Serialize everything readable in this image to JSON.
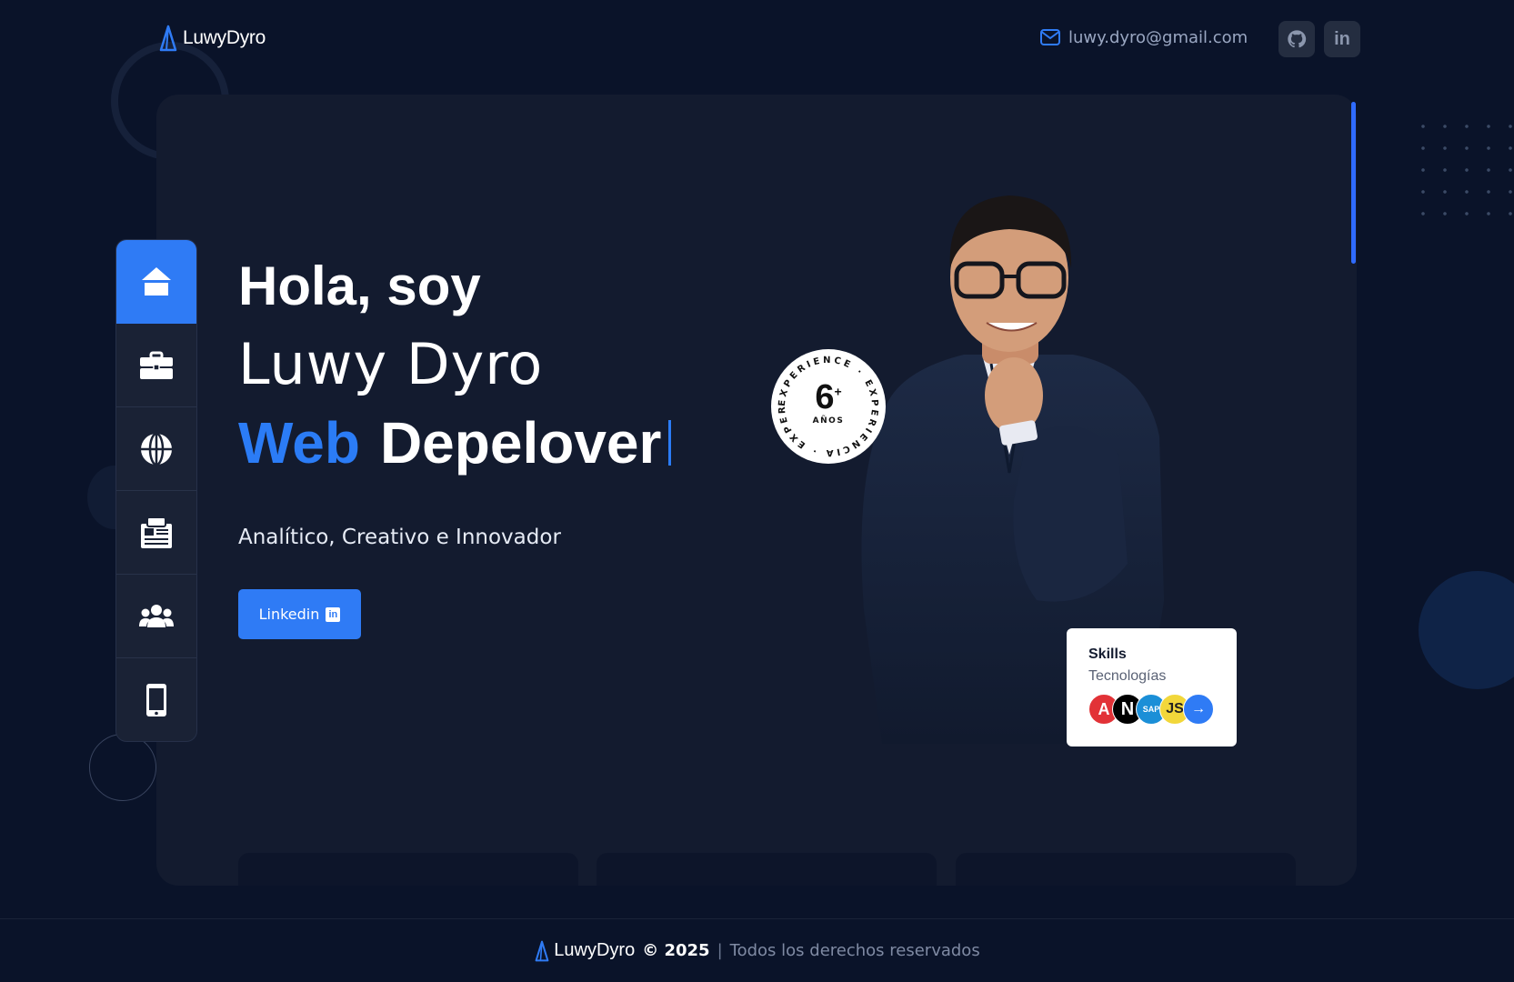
{
  "header": {
    "logo_text": "LuwyDyro",
    "email": "luwy.dyro@gmail.com",
    "social": [
      "github-icon",
      "linkedin-icon"
    ]
  },
  "nav": {
    "items": [
      {
        "icon": "home-icon",
        "active": true
      },
      {
        "icon": "briefcase-icon",
        "active": false
      },
      {
        "icon": "globe-icon",
        "active": false
      },
      {
        "icon": "newspaper-icon",
        "active": false
      },
      {
        "icon": "users-icon",
        "active": false
      },
      {
        "icon": "mobile-icon",
        "active": false
      }
    ]
  },
  "hero": {
    "greeting": "Hola, soy",
    "name": "Luwy Dyro",
    "role_accent": "Web",
    "role_main": "Depelover",
    "tagline": "Analítico, Creativo e Innovador",
    "cta_label": "Linkedin"
  },
  "experience_badge": {
    "number": "6",
    "plus": "+",
    "unit": "AÑOS",
    "ring_text": "EXPERIENCE · EXPERIENCIA · EXPERIENCE ·"
  },
  "skills": {
    "title": "Skills",
    "subtitle": "Tecnologías",
    "techs": [
      {
        "label": "A",
        "icon": "angular-icon"
      },
      {
        "label": "N",
        "icon": "nextjs-icon"
      },
      {
        "label": "SAP",
        "icon": "sap-icon"
      },
      {
        "label": "JS",
        "icon": "javascript-icon"
      },
      {
        "label": "→",
        "icon": "arrow-right-icon"
      }
    ]
  },
  "footer": {
    "logo_text": "LuwyDyro",
    "year": "© 2025",
    "separator": "|",
    "rights": "Todos los derechos reservados"
  },
  "colors": {
    "background": "#0a1329",
    "card": "#131b2f",
    "accent": "#2f7bf5"
  }
}
